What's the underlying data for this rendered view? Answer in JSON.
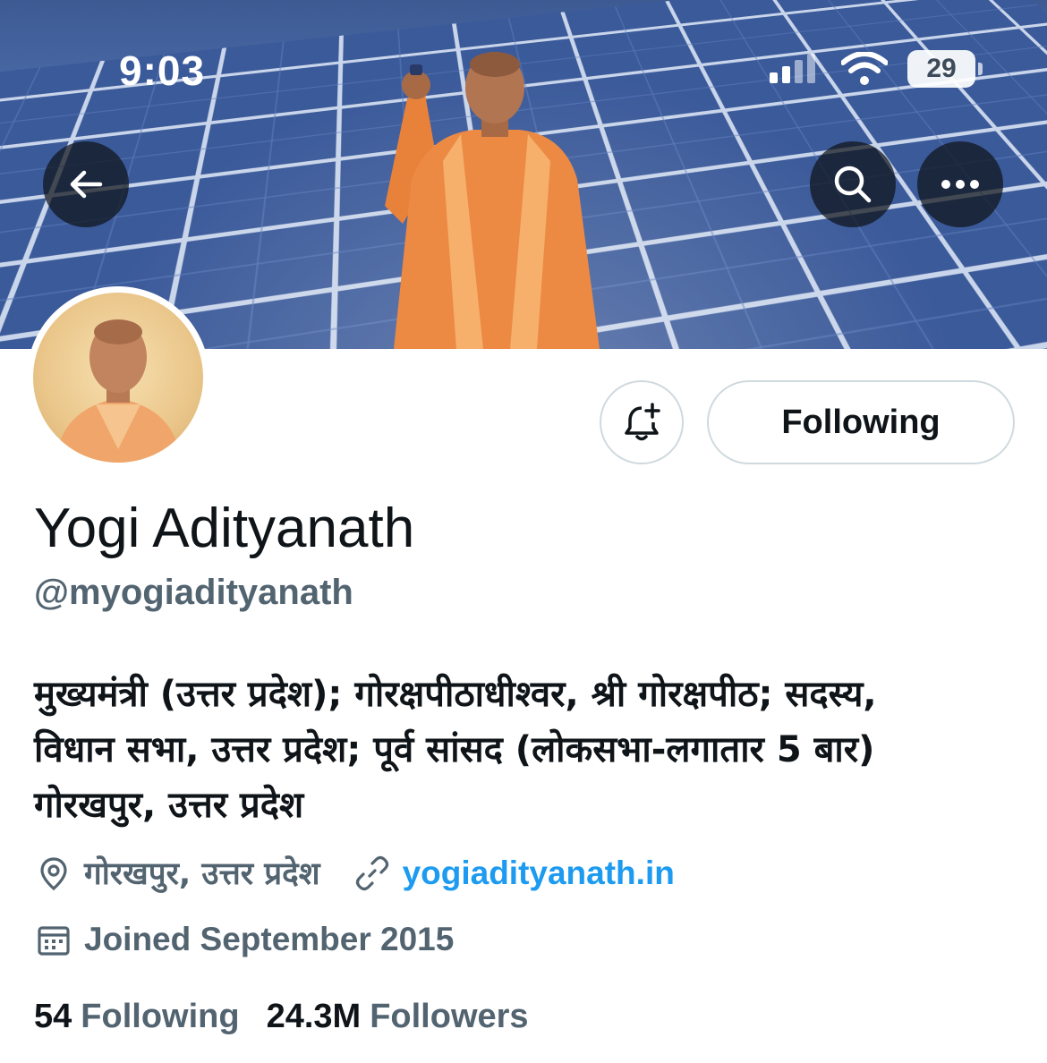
{
  "status_bar": {
    "time": "9:03",
    "battery": "29"
  },
  "profile": {
    "name": "Yogi Adityanath",
    "handle": "@myogiadityanath",
    "bio_lines": [
      "मुख्यमंत्री (उत्तर प्रदेश); गोरक्षपीठाधीश्वर, श्री गोरक्षपीठ; सदस्य,",
      "विधान सभा, उत्तर प्रदेश; पूर्व सांसद (लोकसभा-लगातार 5 बार)",
      "गोरखपुर, उत्तर प्रदेश"
    ],
    "location": "गोरखपुर, उत्तर प्रदेश",
    "website": "yogiadityanath.in",
    "joined": "Joined September 2015",
    "following_count": "54",
    "following_label": "Following",
    "followers_count": "24.3M",
    "followers_label": "Followers"
  },
  "actions": {
    "following_button": "Following"
  },
  "icons": {
    "back": "arrow-left-icon",
    "search": "search-icon",
    "more": "more-icon",
    "notify": "bell-plus-icon",
    "location": "location-pin-icon",
    "link": "link-icon",
    "calendar": "calendar-icon"
  },
  "colors": {
    "link": "#1d9bf0",
    "secondary": "#536471",
    "primary_text": "#0f1419"
  }
}
